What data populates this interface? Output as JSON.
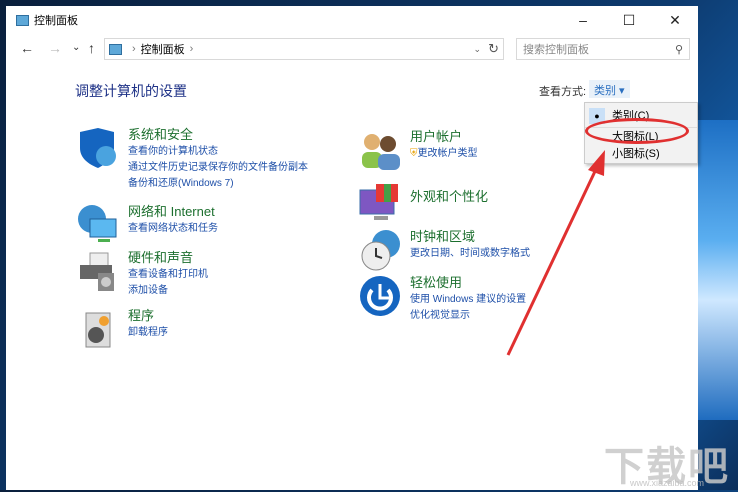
{
  "window": {
    "title": "控制面板",
    "min": "–",
    "max": "☐",
    "close": "✕"
  },
  "nav": {
    "back": "←",
    "forward": "→",
    "recent": "⌄",
    "up": "↑",
    "breadcrumb": "控制面板",
    "sep": "›",
    "search_placeholder": "搜索控制面板"
  },
  "heading": "调整计算机的设置",
  "view": {
    "label": "查看方式:",
    "selected": "类别 ▾",
    "options": [
      "类别(C)",
      "大图标(L)",
      "小图标(S)"
    ]
  },
  "categories": [
    {
      "title": "系统和安全",
      "links": [
        "查看你的计算机状态",
        "通过文件历史记录保存你的文件备份副本",
        "备份和还原(Windows 7)"
      ]
    },
    {
      "title": "网络和 Internet",
      "links": [
        "查看网络状态和任务"
      ]
    },
    {
      "title": "硬件和声音",
      "links": [
        "查看设备和打印机",
        "添加设备"
      ]
    },
    {
      "title": "程序",
      "links": [
        "卸载程序"
      ]
    },
    {
      "title": "用户帐户",
      "links": [
        "更改帐户类型"
      ]
    },
    {
      "title": "外观和个性化",
      "links": []
    },
    {
      "title": "时钟和区域",
      "links": [
        "更改日期、时间或数字格式"
      ]
    },
    {
      "title": "轻松使用",
      "links": [
        "使用 Windows 建议的设置",
        "优化视觉显示"
      ]
    }
  ],
  "watermark": {
    "logo": "下载吧",
    "url": "www.xiazaiba.com"
  },
  "colors": {
    "title_green": "#1c6f2e",
    "link_blue": "#1e4fa8",
    "annotation_red": "#e03030"
  }
}
